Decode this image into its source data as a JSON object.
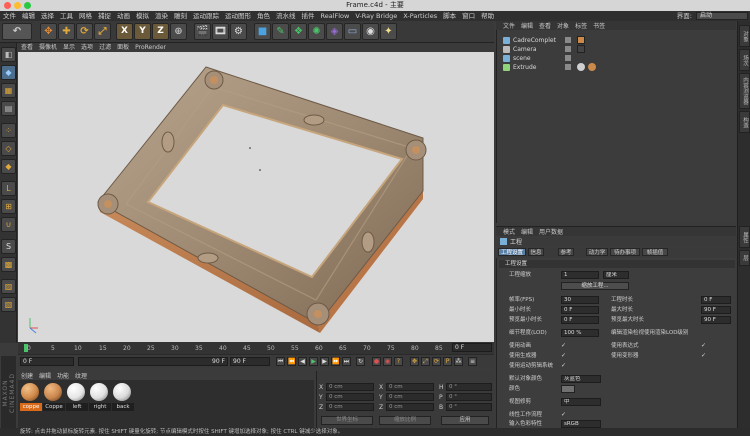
{
  "window": {
    "title": "Frame.c4d - 主要"
  },
  "menubar": {
    "items": [
      "文件",
      "编辑",
      "选择",
      "工具",
      "网格",
      "捕捉",
      "动画",
      "模拟",
      "渲染",
      "雕刻",
      "运动跟踪",
      "运动图形",
      "角色",
      "流水线",
      "插件",
      "RealFlow",
      "V-Ray Bridge",
      "X-Particles",
      "脚本",
      "窗口",
      "帮助"
    ],
    "layout_label": "界面:",
    "layout_value": "启动"
  },
  "toolbar": {
    "icons": [
      "undo-icon",
      "move-icon",
      "add-icon",
      "rotate-icon",
      "scale-icon",
      "x-axis-icon",
      "y-axis-icon",
      "z-axis-icon",
      "world-coords-icon",
      "render-view-icon",
      "render-picture-icon",
      "render-settings-icon",
      "cube-icon",
      "pen-icon",
      "subdivision-icon",
      "array-icon",
      "deformer-icon",
      "floor-icon",
      "camera-icon",
      "light-icon"
    ],
    "axes": [
      "X",
      "Y",
      "Z"
    ]
  },
  "lefttools": {
    "icons": [
      "make-editable-icon",
      "model-mode-icon",
      "texture-mode-icon",
      "workplane-icon",
      "points-mode-icon",
      "edges-mode-icon",
      "polygons-mode-icon",
      "axis-icon",
      "snap-icon",
      "magnet-icon",
      "solo-icon",
      "grid-icon"
    ]
  },
  "viewport": {
    "menu": [
      "查看",
      "摄像机",
      "显示",
      "选项",
      "过滤",
      "面板",
      "ProRender"
    ]
  },
  "timeline": {
    "ticks": [
      "0",
      "5",
      "10",
      "15",
      "20",
      "25",
      "30",
      "35",
      "40",
      "45",
      "50",
      "55",
      "60",
      "65",
      "70",
      "75",
      "80",
      "85",
      "90"
    ],
    "current_frame": "0 F",
    "start": "0 F",
    "end": "90 F",
    "end2": "90 F",
    "right_field": "0 F"
  },
  "materials": {
    "menu": [
      "创建",
      "编辑",
      "功能",
      "纹理"
    ],
    "items": [
      {
        "label": "coppe",
        "color": "#d08a4a"
      },
      {
        "label": "Coppe",
        "color": "#c9874e"
      },
      {
        "label": "left",
        "color": "#e6e6e6"
      },
      {
        "label": "right",
        "color": "#e0e0e0"
      },
      {
        "label": "back",
        "color": "#dadada"
      }
    ]
  },
  "coords": {
    "rows": [
      {
        "a": "X",
        "av": "0 cm",
        "b": "X",
        "bv": "0 cm",
        "c": "H",
        "cv": "0 °"
      },
      {
        "a": "Y",
        "av": "0 cm",
        "b": "Y",
        "bv": "0 cm",
        "c": "P",
        "cv": "0 °"
      },
      {
        "a": "Z",
        "av": "0 cm",
        "b": "Z",
        "bv": "0 cm",
        "c": "B",
        "cv": "0 °"
      }
    ],
    "space": "世界坐标",
    "mode": "缩放比例",
    "apply": "应用"
  },
  "status": "旋转: 点击并拖动鼠标旋转元素. 按住 SHIFT 键量化旋转; 节点编辑模式时按住 SHIFT 键增加选择对象; 按住 CTRL 键减少选择对象。",
  "maxon": "MAXON CINEMA4D",
  "objects": {
    "menu": [
      "文件",
      "编辑",
      "查看",
      "对象",
      "标签",
      "书签"
    ],
    "items": [
      {
        "name": "CadreComplet",
        "color": "#7ab0d8"
      },
      {
        "name": "Camera",
        "color": "#bbbbbb"
      },
      {
        "name": "scene",
        "color": "#7ab0d8"
      },
      {
        "name": "Extrude",
        "color": "#8fd47a"
      }
    ]
  },
  "sidetabs": [
    "对象",
    "场次",
    "内容浏览器",
    "构造",
    "属性",
    "层"
  ],
  "attributes": {
    "menu": [
      "模式",
      "编辑",
      "用户数据"
    ],
    "header": "工程",
    "tabs": [
      "工程设置",
      "信息",
      "参考",
      "动力学",
      "待办事项",
      "帧插值"
    ],
    "section1": "工程设置",
    "scale_label": "工程缩放",
    "scale_value": "1",
    "scale_unit": "厘米",
    "scale_button": "缩放工程...",
    "fps_label": "帧率(FPS)",
    "fps_value": "30",
    "min_time_label": "最小时长",
    "min_time_value": "0 F",
    "preview_min_label": "预览最小时长",
    "preview_min_value": "0 F",
    "time_label": "工程时长",
    "time_value": "0 F",
    "max_time_label": "最大时长",
    "max_time_value": "90 F",
    "preview_max_label": "预览最大时长",
    "preview_max_value": "90 F",
    "lod_label": "细节程度(LOD)",
    "lod_value": "100 %",
    "render_lod_label": "编辑渲染检视使用渲染LOD级别",
    "use_anim_label": "使用动画",
    "use_expr_label": "使用表达式",
    "use_gen_label": "使用生成器",
    "use_deform_label": "使用变形器",
    "use_motion_label": "使用运动剪辑系统",
    "default_color_label": "默认对象颜色",
    "default_color_value": "灰蓝色",
    "color_label": "颜色",
    "view_clip_label": "视图修剪",
    "view_clip_value": "中",
    "linear_label": "线性工作流程",
    "input_color_label": "输入色彩特性",
    "input_color_value": "sRGB"
  }
}
